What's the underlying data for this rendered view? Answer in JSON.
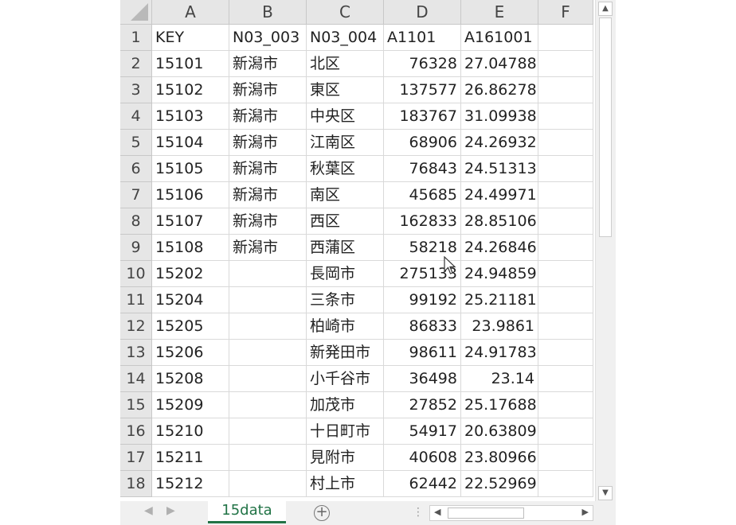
{
  "sheet_tab": "15data",
  "columns": [
    "A",
    "B",
    "C",
    "D",
    "E",
    "F"
  ],
  "rows": [
    {
      "n": "1",
      "cells": [
        "KEY",
        "N03_003",
        "N03_004",
        "A1101",
        "A161001",
        ""
      ]
    },
    {
      "n": "2",
      "cells": [
        "15101",
        "新潟市",
        "北区",
        "76328",
        "27.04788",
        ""
      ]
    },
    {
      "n": "3",
      "cells": [
        "15102",
        "新潟市",
        "東区",
        "137577",
        "26.86278",
        ""
      ]
    },
    {
      "n": "4",
      "cells": [
        "15103",
        "新潟市",
        "中央区",
        "183767",
        "31.09938",
        ""
      ]
    },
    {
      "n": "5",
      "cells": [
        "15104",
        "新潟市",
        "江南区",
        "68906",
        "24.26932",
        ""
      ]
    },
    {
      "n": "6",
      "cells": [
        "15105",
        "新潟市",
        "秋葉区",
        "76843",
        "24.51313",
        ""
      ]
    },
    {
      "n": "7",
      "cells": [
        "15106",
        "新潟市",
        "南区",
        "45685",
        "24.49971",
        ""
      ]
    },
    {
      "n": "8",
      "cells": [
        "15107",
        "新潟市",
        "西区",
        "162833",
        "28.85106",
        ""
      ]
    },
    {
      "n": "9",
      "cells": [
        "15108",
        "新潟市",
        "西蒲区",
        "58218",
        "24.26846",
        ""
      ]
    },
    {
      "n": "10",
      "cells": [
        "15202",
        "",
        "長岡市",
        "275133",
        "24.94859",
        ""
      ]
    },
    {
      "n": "11",
      "cells": [
        "15204",
        "",
        "三条市",
        "99192",
        "25.21181",
        ""
      ]
    },
    {
      "n": "12",
      "cells": [
        "15205",
        "",
        "柏崎市",
        "86833",
        "23.9861",
        ""
      ]
    },
    {
      "n": "13",
      "cells": [
        "15206",
        "",
        "新発田市",
        "98611",
        "24.91783",
        ""
      ]
    },
    {
      "n": "14",
      "cells": [
        "15208",
        "",
        "小千谷市",
        "36498",
        "23.14",
        ""
      ]
    },
    {
      "n": "15",
      "cells": [
        "15209",
        "",
        "加茂市",
        "27852",
        "25.17688",
        ""
      ]
    },
    {
      "n": "16",
      "cells": [
        "15210",
        "",
        "十日町市",
        "54917",
        "20.63809",
        ""
      ]
    },
    {
      "n": "17",
      "cells": [
        "15211",
        "",
        "見附市",
        "40608",
        "23.80966",
        ""
      ]
    },
    {
      "n": "18",
      "cells": [
        "15212",
        "",
        "村上市",
        "62442",
        "22.52969",
        ""
      ]
    }
  ]
}
